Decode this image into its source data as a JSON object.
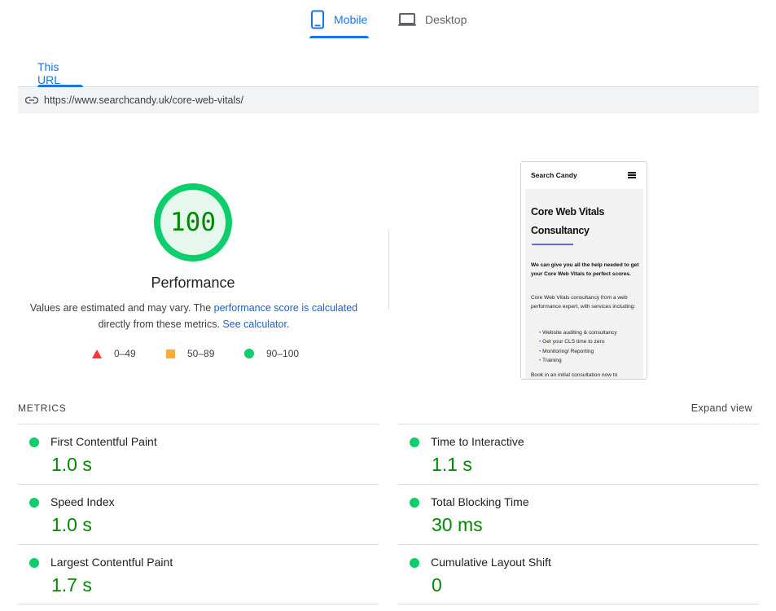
{
  "device_tabs": {
    "mobile": {
      "label": "Mobile",
      "icon": "smartphone-icon"
    },
    "desktop": {
      "label": "Desktop",
      "icon": "laptop-icon"
    }
  },
  "url_tab": {
    "label": "This URL"
  },
  "url": {
    "icon": "link-icon",
    "text": "https://www.searchcandy.uk/core-web-vitals/"
  },
  "performance": {
    "score": "100",
    "score_value": 100,
    "title": "Performance",
    "desc_prefix": "Values are estimated and may vary. The ",
    "desc_link1": "performance score is calculated",
    "desc_middle": " directly from these metrics. ",
    "desc_link2": "See calculator",
    "desc_suffix": ".",
    "color": "#0cce6b"
  },
  "legend": {
    "fail": "0–49",
    "average": "50–89",
    "pass": "90–100",
    "colors": {
      "fail": "#ff3333",
      "average": "#ffaa33",
      "pass": "#0cce6b"
    }
  },
  "screenshot": {
    "brand": "Search Candy",
    "heading": "Core Web Vitals Consultancy",
    "lead": "We can give you all the help needed to get your Core Web Vitals to perfect scores.",
    "paragraph": "Core Web Vitals consultancy from a web performance expert, with services including:",
    "list": [
      "Website auditing & consultancy",
      "Get your CLS time to zero",
      "Monitoring/ Reporting",
      "Training"
    ],
    "tail": "Book in an initial consultation now to"
  },
  "metrics": {
    "title": "METRICS",
    "expand_label": "Expand view",
    "items": [
      {
        "name": "First Contentful Paint",
        "value": "1.0 s"
      },
      {
        "name": "Time to Interactive",
        "value": "1.1 s"
      },
      {
        "name": "Speed Index",
        "value": "1.0 s"
      },
      {
        "name": "Total Blocking Time",
        "value": "30 ms"
      },
      {
        "name": "Largest Contentful Paint",
        "value": "1.7 s"
      },
      {
        "name": "Cumulative Layout Shift",
        "value": "0"
      }
    ]
  }
}
